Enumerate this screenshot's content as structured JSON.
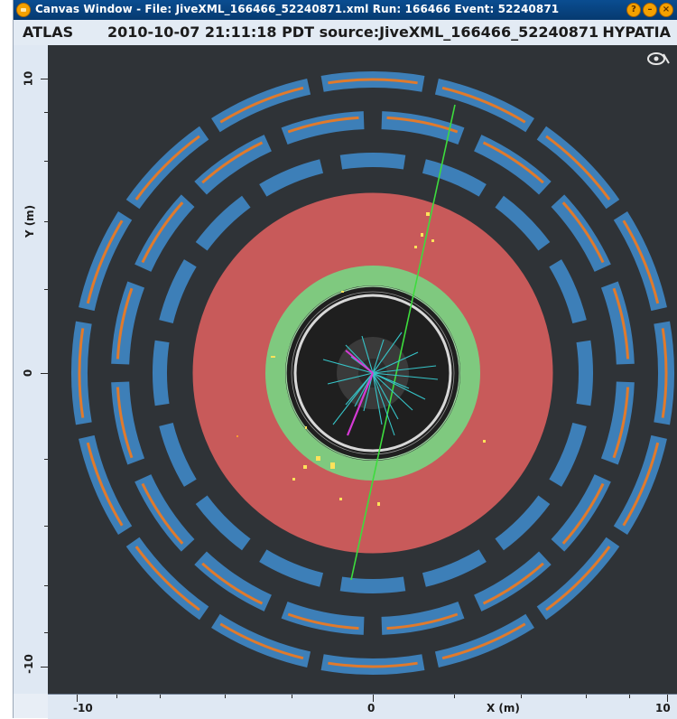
{
  "window": {
    "title": "Canvas Window -  File: JiveXML_166466_52240871.xml  Run: 166466  Event: 52240871",
    "buttons": [
      "help-button",
      "minimize-button",
      "close-button"
    ]
  },
  "header": {
    "experiment": "ATLAS",
    "info": "2010-10-07 21:11:18 PDT source:JiveXML_166466_52240871",
    "app": "HYPATIA"
  },
  "axes": {
    "y_label": "Y (m)",
    "x_label": "X (m)",
    "y_ticks": [
      "10",
      "0",
      "-10"
    ],
    "x_ticks": [
      "-10",
      "0",
      "10"
    ]
  },
  "colors": {
    "background": "#2f3337",
    "muon_chamber": "#3d7fb8",
    "muon_strip": "#e07a2c",
    "hadron_calorimeter": "#c85a5a",
    "em_calorimeter": "#7fc97f",
    "inner_detector": "#1f1f1f",
    "track": "#36c5c9",
    "muon_track": "#3ddc3d",
    "electron_track": "#d63ad6",
    "hit": "#ffe25a"
  }
}
